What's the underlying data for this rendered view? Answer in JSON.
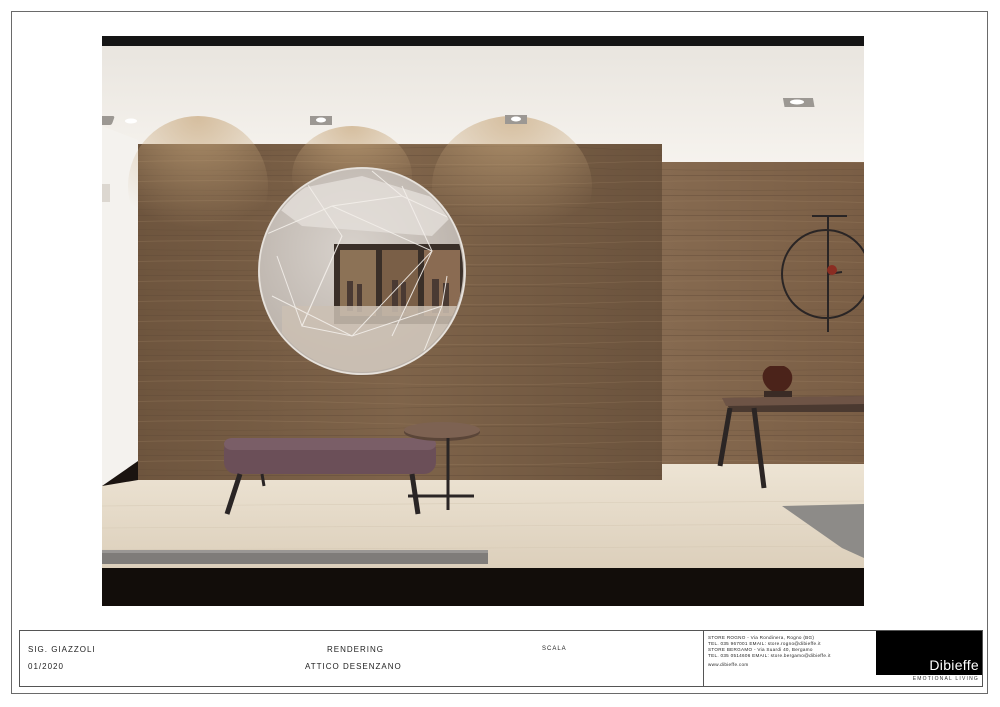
{
  "title_block": {
    "client": "SIG. GIAZZOLI",
    "date": "01/2020",
    "type": "RENDERING",
    "project": "ATTICO DESENZANO",
    "scale_label": "SCALA",
    "contact_lines": [
      "STORE ROGNO - Via Rondinera, Rogno (BG)",
      "TEL. 035 967001 EMAIL: store.rogno@dibieffe.it",
      "STORE BERGAMO - Via Suardi 40, Bergamo",
      "TEL. 035 0514606 EMAIL: store.bergamo@dibieffe.it",
      "www.dibieffe.com"
    ],
    "brand_name": "Dibieffe",
    "brand_tagline": "EMOTIONAL LIVING"
  },
  "render": {
    "scene": "entrance-hall-rendering",
    "colors": {
      "wood": "#7a5f45",
      "ceiling": "#f0ece6",
      "floor": "#e6dccb",
      "bench": "#6b4f58",
      "frame": "#1a1a1a"
    }
  }
}
